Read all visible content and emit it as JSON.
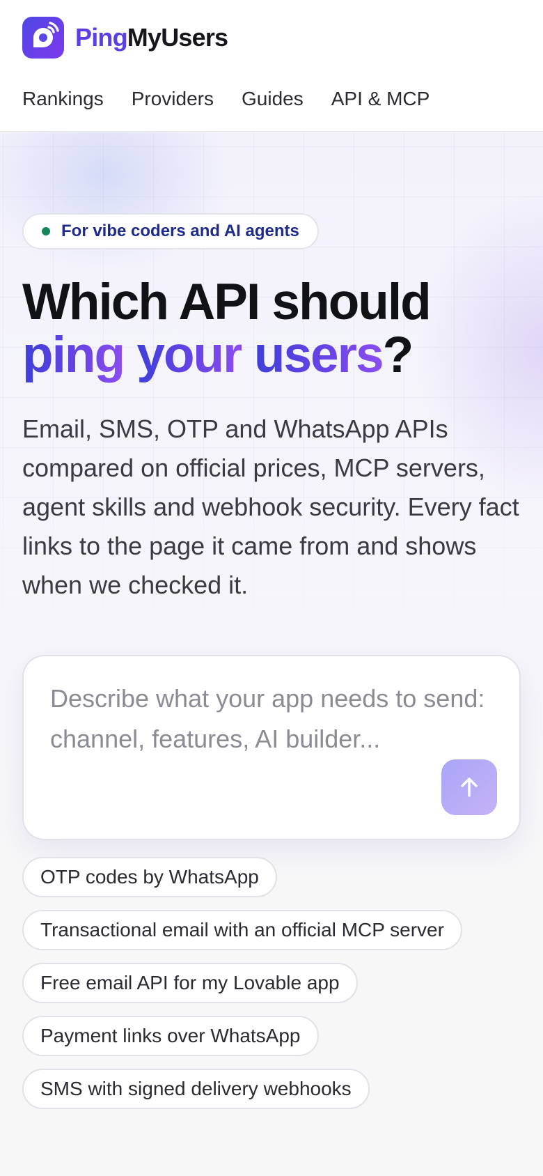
{
  "brand": {
    "name_part1": "Ping",
    "name_part2": "MyUsers",
    "logo_icon": "ping-bubble-icon",
    "colors": {
      "accent": "#5b3ee6",
      "accent_gradient_start": "#4f46e5",
      "accent_gradient_end": "#7c3aed"
    }
  },
  "nav": {
    "items": [
      {
        "label": "Rankings"
      },
      {
        "label": "Providers"
      },
      {
        "label": "Guides"
      },
      {
        "label": "API & MCP"
      }
    ]
  },
  "hero": {
    "badge": "For vibe coders and AI agents",
    "badge_dot_color": "#16865a",
    "title_line1": "Which API should",
    "title_ping": "ping",
    "title_your": "your",
    "title_users": "users",
    "title_qmark": "?",
    "description": "Email, SMS, OTP and WhatsApp APIs compared on official prices, MCP servers, agent skills and webhook security. Every fact links to the page it came from and shows when we checked it."
  },
  "prompt": {
    "placeholder": "Describe what your app needs to send: channel, features, AI builder...",
    "value": "",
    "send_icon": "arrow-up-icon"
  },
  "suggestions": [
    {
      "label": "OTP codes by WhatsApp"
    },
    {
      "label": "Transactional email with an official MCP server"
    },
    {
      "label": "Free email API for my Lovable app"
    },
    {
      "label": "Payment links over WhatsApp"
    },
    {
      "label": "SMS with signed delivery webhooks"
    }
  ]
}
